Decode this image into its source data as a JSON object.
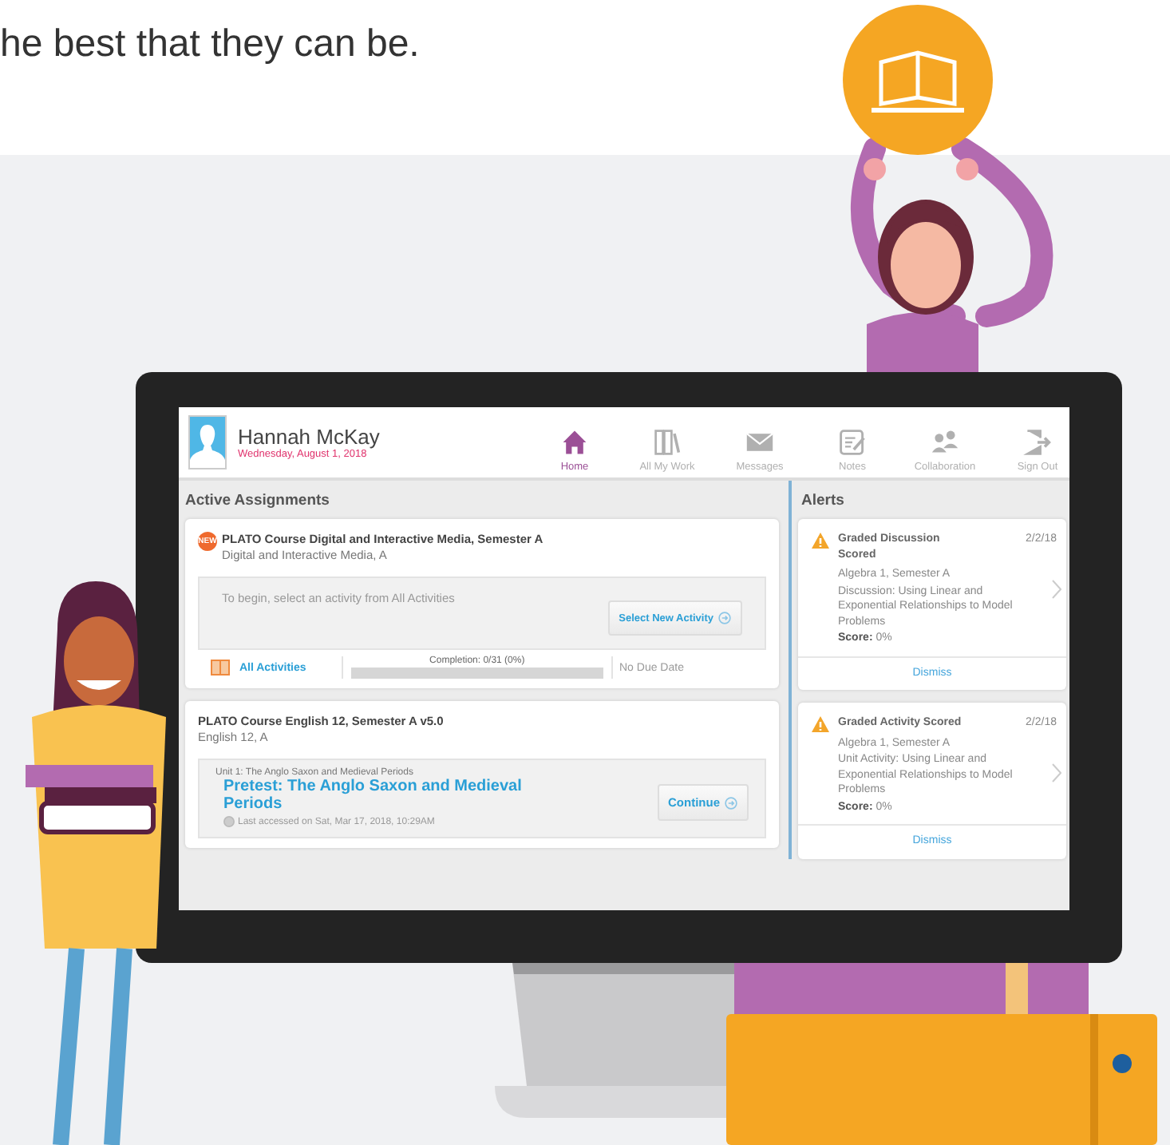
{
  "headline": "he best that they can be.",
  "app": {
    "user": {
      "name": "Hannah McKay",
      "date": "Wednesday, August 1, 2018"
    },
    "nav": [
      {
        "label": "Home",
        "selected": true,
        "kind": "home"
      },
      {
        "label": "All My Work",
        "selected": false,
        "kind": "work"
      },
      {
        "label": "Messages",
        "selected": false,
        "kind": "messages"
      },
      {
        "label": "Notes",
        "selected": false,
        "kind": "notes"
      },
      {
        "label": "Collaboration",
        "selected": false,
        "kind": "collaboration"
      },
      {
        "label": "Sign Out",
        "selected": false,
        "kind": "signout"
      }
    ],
    "assignments_title": "Active Assignments",
    "assignments": [
      {
        "kind": "start",
        "badge": "NEW",
        "title": "PLATO Course Digital and Interactive Media, Semester A",
        "subtitle": "Digital and Interactive Media, A",
        "prompt": "To begin, select an activity from All Activities",
        "button": "Select New Activity",
        "link": "All Activities",
        "completion": "Completion: 0/31 (0%)",
        "level": 0,
        "due": "No Due Date"
      },
      {
        "kind": "continue",
        "title": "PLATO Course English 12, Semester A v5.0",
        "subtitle": "English 12, A",
        "unit": "Unit 1: The Anglo Saxon and Medieval Periods",
        "activity": "Pretest: The Anglo Saxon and Medieval Periods",
        "last_accessed": "Last accessed on Sat, Mar 17, 2018, 10:29AM",
        "button": "Continue"
      }
    ],
    "alerts_title": "Alerts",
    "alerts": [
      {
        "title": "Graded Discussion Scored",
        "date": "2/2/18",
        "course": "Algebra 1, Semester A",
        "detail": "Discussion: Using Linear and Exponential Relationships to Model Problems",
        "score": "**Score:** 0%",
        "dismiss": "Dismiss"
      },
      {
        "title": "Graded Activity Scored",
        "date": "2/2/18",
        "course": "Algebra 1, Semester A",
        "detail": "Unit Activity: Using Linear and Exponential Relationships to Model Problems",
        "score": "**Score:** 0%",
        "dismiss": "Dismiss"
      }
    ]
  }
}
